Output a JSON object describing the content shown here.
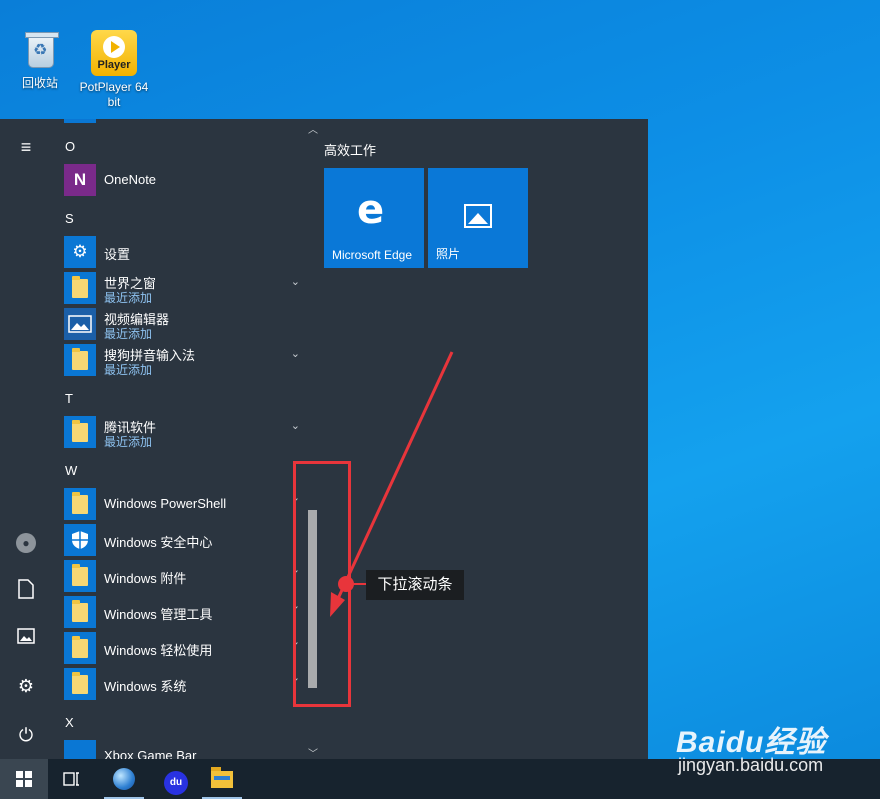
{
  "desktop": {
    "icons": [
      {
        "label": "回收站"
      },
      {
        "label": "PotPlayer 64 bit",
        "badge": "Player"
      }
    ]
  },
  "start_menu": {
    "rail_icons": [
      "hamburger-menu-icon",
      "user-avatar-icon",
      "documents-icon",
      "pictures-icon",
      "settings-icon",
      "power-icon"
    ],
    "letters": [
      "O",
      "S",
      "T",
      "W",
      "X"
    ],
    "apps": [
      {
        "name": "OneNote",
        "icon_text": "N"
      },
      {
        "name": "设置",
        "icon_text": "⚙"
      },
      {
        "name": "世界之窗",
        "sub": "最近添加"
      },
      {
        "name": "视频编辑器",
        "sub": "最近添加"
      },
      {
        "name": "搜狗拼音输入法",
        "sub": "最近添加"
      },
      {
        "name": "腾讯软件",
        "sub": "最近添加"
      },
      {
        "name": "Windows PowerShell"
      },
      {
        "name": "Windows 安全中心"
      },
      {
        "name": "Windows 附件"
      },
      {
        "name": "Windows 管理工具"
      },
      {
        "name": "Windows 轻松使用"
      },
      {
        "name": "Windows 系统"
      },
      {
        "name": "Xbox Game Bar"
      }
    ],
    "chevron": "⌄",
    "tiles_group": "高效工作",
    "tiles": [
      {
        "label": "Microsoft Edge",
        "icon_text": "e"
      },
      {
        "label": "照片"
      }
    ]
  },
  "annotation": {
    "callout": "下拉滚动条",
    "color": "#e8353b"
  },
  "taskbar": {
    "buttons": [
      "start-button",
      "task-view-button",
      "browser-button",
      "baidu-button",
      "file-explorer-button"
    ],
    "baidu_text": "du"
  },
  "watermark": {
    "logo": "Baidu经验",
    "url": "jingyan.baidu.com"
  }
}
